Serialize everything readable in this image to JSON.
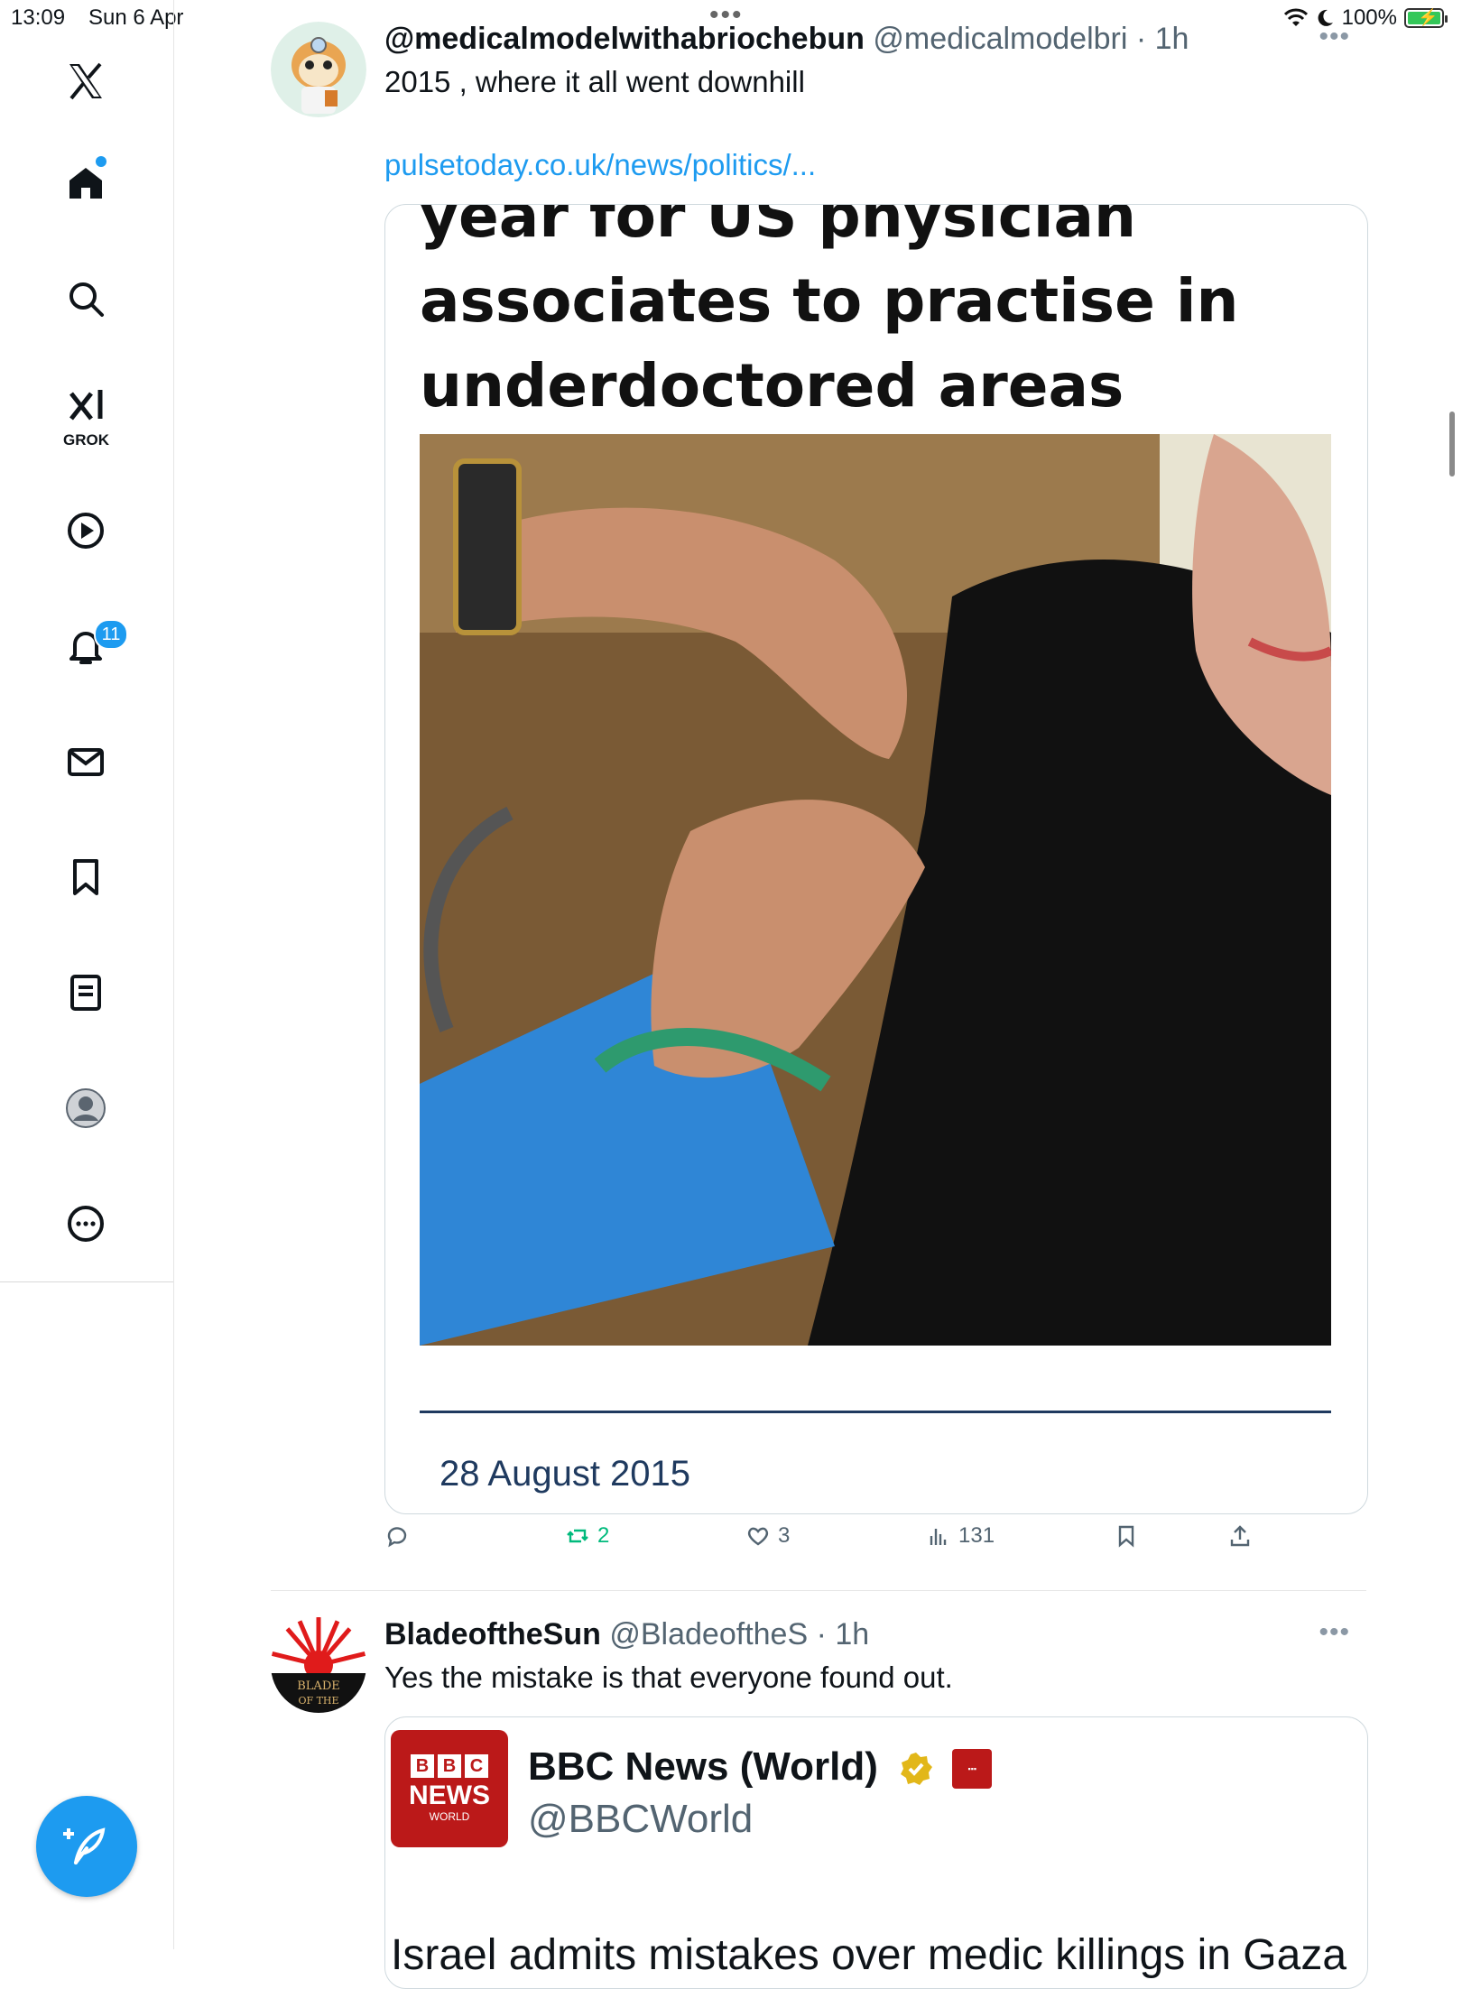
{
  "status_bar": {
    "time": "13:09",
    "date": "Sun 6 Apr",
    "battery": "100%"
  },
  "sidebar": {
    "items": [
      {
        "icon": "x-logo-icon"
      },
      {
        "icon": "home-icon"
      },
      {
        "icon": "search-icon"
      },
      {
        "icon": "grok-icon",
        "label": "GROK"
      },
      {
        "icon": "video-play-icon"
      },
      {
        "icon": "bell-icon",
        "badge": "11"
      },
      {
        "icon": "mail-icon"
      },
      {
        "icon": "bookmark-icon"
      },
      {
        "icon": "lists-icon"
      },
      {
        "icon": "profile-icon"
      },
      {
        "icon": "more-icon"
      }
    ],
    "compose_icon": "compose-feather-icon"
  },
  "posts": [
    {
      "display_name": "@medicalmodelwithabriochebun",
      "handle": "@medicalmodelbri",
      "time": "· 1h",
      "text": "2015 , where it all went downhill",
      "link": "pulsetoday.co.uk/news/politics/...",
      "card": {
        "headline_lines": [
          "year for US physician",
          "associates to practise in",
          "underdoctored areas"
        ],
        "date": "28 August 2015"
      },
      "actions": {
        "reply": "",
        "reposts": "2",
        "likes": "3",
        "views": "131"
      }
    },
    {
      "display_name": "BladeoftheSun",
      "handle": "@BladeoftheS",
      "time": "· 1h",
      "text": "Yes the mistake is that everyone found out.",
      "embed": {
        "logo_top": [
          "B",
          "B",
          "C"
        ],
        "logo_news": "NEWS",
        "logo_world": "WORLD",
        "name": "BBC News (World)",
        "handle": "@BBCWorld",
        "headline": "Israel admits mistakes over medic killings in Gaza"
      }
    }
  ],
  "colors": {
    "accent": "#1d9bf0",
    "repost_green": "#00ba7c",
    "bbc_red": "#bb1919"
  }
}
